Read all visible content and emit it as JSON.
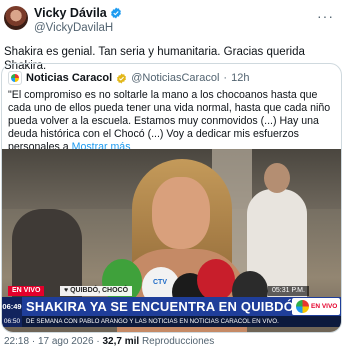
{
  "author": {
    "name": "Vicky Dávila",
    "handle": "@VickyDavilaH",
    "verified": true,
    "more_icon": "more-horizontal-icon"
  },
  "tweet_text": "Shakira es genial. Tan seria y humanitaria. Gracias querida Shakira.",
  "quoted_tweet": {
    "name": "Noticias Caracol",
    "handle": "@NoticiasCaracol",
    "separator": "·",
    "time": "12h",
    "verified": true,
    "text": "\"El compromiso es no soltarle la mano a los chocoanos hasta que cada uno de ellos pueda tener una vida normal, hasta que cada niño pueda volver a la escuela. Estamos muy conmovidos (...) Hay una deuda histórica con el Chocó (...) Voy a dedicar mis esfuerzos personales a",
    "show_more": "Mostrar más",
    "video": {
      "live_tag": "EN VIVO",
      "location": "♥ QUIBDÓ, CHOCÓ",
      "clock": "05:31 P.M.",
      "headline_time": "06:49",
      "headline": "SHAKIRA YA SE ENCUENTRA EN QUIBDÓ",
      "channel_tag": "EN VIVO",
      "ticker_time": "06:50",
      "ticker": "DE SEMANA CON PABLO ARANGO Y LAS NOTICIAS EN NOTICIAS CARACOL EN VIVO.",
      "mic_logo": "CTV"
    }
  },
  "footer": {
    "time": "22:18",
    "dot1": "·",
    "date": "17 ago 2026",
    "dot2": "·",
    "views": "32,7 mil",
    "views_label": "Reproducciones"
  }
}
